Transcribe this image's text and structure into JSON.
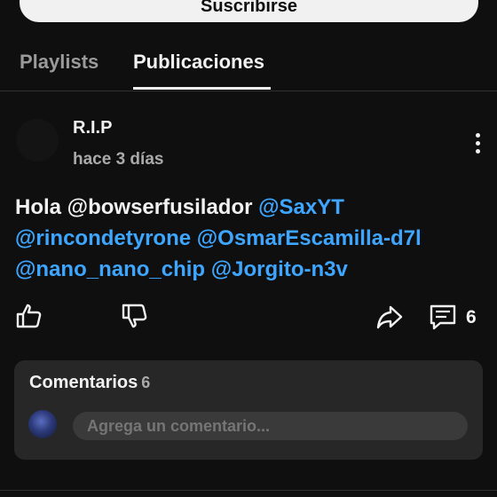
{
  "header": {
    "subscribe_label": "Suscribirse"
  },
  "tabs": [
    {
      "label": "Playlists",
      "active": false
    },
    {
      "label": "Publicaciones",
      "active": true
    }
  ],
  "post": {
    "author": "R.I.P",
    "time": "hace 3 días",
    "text_prefix": "Hola @bowserfusilador ",
    "mentions": [
      "@SaxYT",
      "@rincondetyrone",
      "@OsmarEscamilla-d7l",
      "@nano_nano_chip",
      "@Jorgito-n3v"
    ],
    "comment_count": "6",
    "icons": [
      "like-icon",
      "dislike-icon",
      "share-icon",
      "comment-icon",
      "more-vertical-icon"
    ]
  },
  "comments": {
    "title": "Comentarios",
    "count": "6",
    "input_placeholder": "Agrega un comentario..."
  },
  "colors": {
    "background": "#0f0f0f",
    "mention": "#3ea6ff",
    "panel": "#272727"
  }
}
